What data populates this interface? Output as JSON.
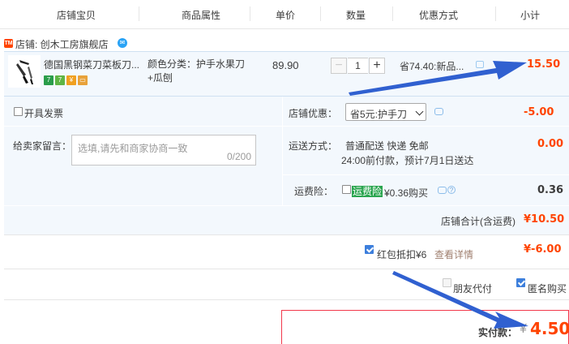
{
  "header": {
    "col_item": "店铺宝贝",
    "col_attr": "商品属性",
    "col_price": "单价",
    "col_qty": "数量",
    "col_promo": "优惠方式",
    "col_subtotal": "小计"
  },
  "shop": {
    "badge": "TM",
    "label": "店铺: 创木工房旗舰店"
  },
  "item": {
    "title": "德国黑钢菜刀菜板刀...",
    "attr_line1": "颜色分类：护手水果刀",
    "attr_line2": "+瓜刨",
    "price": "89.90",
    "qty": "1",
    "qty_minus": "−",
    "qty_plus": "+",
    "promo": "省74.40:新品...",
    "subtotal": "15.50",
    "badges": [
      "7",
      "7",
      "¥",
      "▭"
    ]
  },
  "invoice": {
    "label": "开具发票"
  },
  "shop_discount": {
    "label": "店铺优惠：",
    "selected": "省5元:护手刀",
    "amount": "-5.00"
  },
  "message": {
    "label": "给卖家留言：",
    "placeholder": "选填,请先和商家协商一致",
    "counter": "0/200"
  },
  "shipping": {
    "label": "运送方式：",
    "line1": "普通配送 快递 免邮",
    "line2": "24:00前付款，预计7月1日送达",
    "amount": "0.00"
  },
  "insurance": {
    "label": "运费险：",
    "tag": "运费险",
    "price": "¥0.36购买",
    "amount": "0.36"
  },
  "shop_total": {
    "label": "店铺合计(含运费)",
    "amount": "¥10.50"
  },
  "redpack": {
    "label": "红包抵扣¥6",
    "link": "查看详情",
    "amount": "¥-6.00"
  },
  "options": {
    "friend_pay": "朋友代付",
    "anonymous": "匿名购买"
  },
  "pay": {
    "label": "实付款：",
    "currency": "¥",
    "amount": "4.50"
  },
  "colors": {
    "accent": "#ff4400",
    "panel_bg": "#f3f8fd",
    "arrow": "#3060d0",
    "checkbox": "#3d7fdc"
  }
}
